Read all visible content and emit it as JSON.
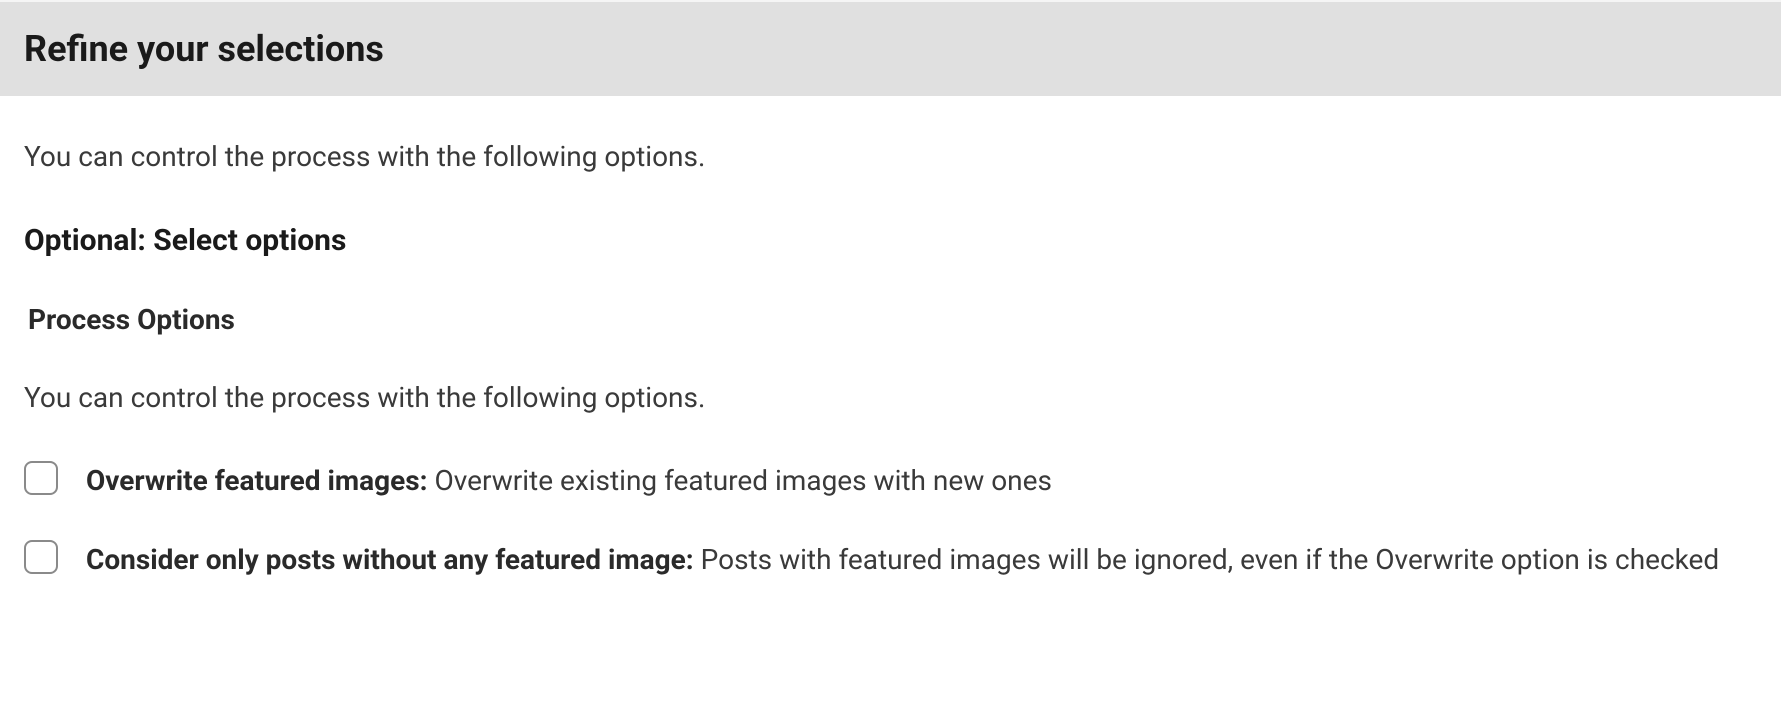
{
  "header": {
    "title": "Refine your selections"
  },
  "content": {
    "intro": "You can control the process with the following options.",
    "subheading": "Optional: Select options",
    "options_title": "Process Options",
    "options_intro": "You can control the process with the following options.",
    "checkboxes": [
      {
        "bold": "Overwrite featured images:",
        "rest": " Overwrite existing featured images with new ones"
      },
      {
        "bold": "Consider only posts without any featured image:",
        "rest": " Posts with featured images will be ignored, even if the Overwrite option is checked"
      }
    ]
  }
}
